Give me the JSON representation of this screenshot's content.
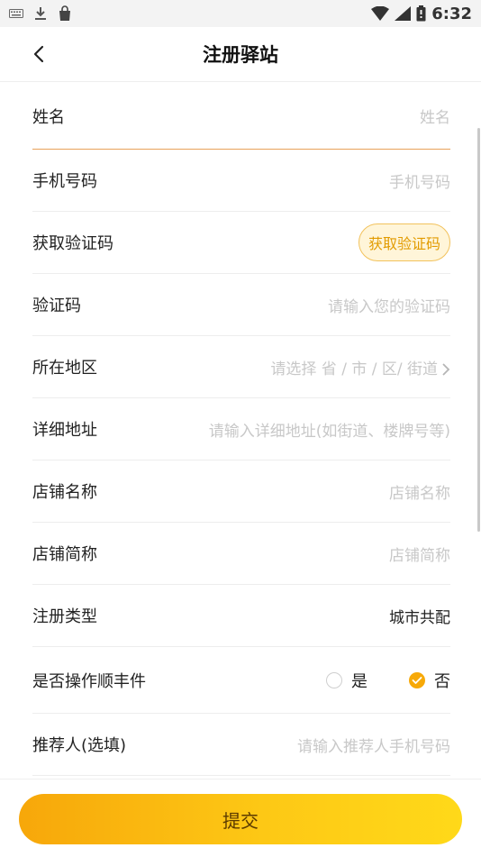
{
  "status_bar": {
    "time": "6:32"
  },
  "header": {
    "title": "注册驿站"
  },
  "form": {
    "name": {
      "label": "姓名",
      "placeholder": "姓名"
    },
    "phone": {
      "label": "手机号码",
      "placeholder": "手机号码"
    },
    "get_code": {
      "label": "获取验证码",
      "button": "获取验证码"
    },
    "code": {
      "label": "验证码",
      "placeholder": "请输入您的验证码"
    },
    "region": {
      "label": "所在地区",
      "placeholder": "请选择 省 / 市 / 区/ 街道"
    },
    "address": {
      "label": "详细地址",
      "placeholder": "请输入详细地址(如街道、楼牌号等)"
    },
    "store_name": {
      "label": "店铺名称",
      "placeholder": "店铺名称"
    },
    "store_short": {
      "label": "店铺简称",
      "placeholder": "店铺简称"
    },
    "reg_type": {
      "label": "注册类型",
      "value": "城市共配"
    },
    "sf_parcel": {
      "label": "是否操作顺丰件",
      "options": [
        "是",
        "否"
      ],
      "selected": "否"
    },
    "referrer": {
      "label": "推荐人(选填)",
      "placeholder": "请输入推荐人手机号码"
    }
  },
  "submit": {
    "label": "提交"
  },
  "colors": {
    "accent": "#f7a908",
    "active_underline": "#e8a15a"
  }
}
